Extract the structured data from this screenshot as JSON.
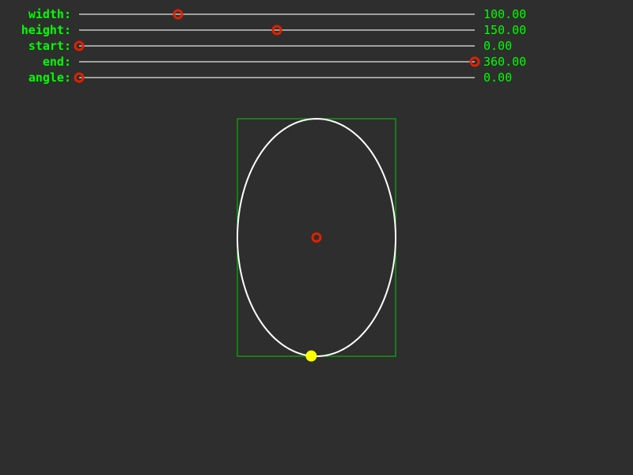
{
  "colors": {
    "background": "#2e2e2e",
    "text": "#00ff00",
    "track": "#a0a0a0",
    "handle": "#dd2200",
    "bounding_box": "#00cc00",
    "ellipse": "#ffffff",
    "endpoint": "#ffff00"
  },
  "sliders": [
    {
      "key": "width",
      "label": "width:",
      "value": 100,
      "value_text": "100.00",
      "min": 0,
      "max": 400
    },
    {
      "key": "height",
      "label": "height:",
      "value": 150,
      "value_text": "150.00",
      "min": 0,
      "max": 300
    },
    {
      "key": "start",
      "label": "start:",
      "value": 0,
      "value_text": "0.00",
      "min": 0,
      "max": 360
    },
    {
      "key": "end",
      "label": "end:",
      "value": 360,
      "value_text": "360.00",
      "min": 0,
      "max": 360
    },
    {
      "key": "angle",
      "label": "angle:",
      "value": 0,
      "value_text": "0.00",
      "min": 0,
      "max": 360
    }
  ],
  "ellipse": {
    "endpoint_angle_deg": 93.8
  }
}
